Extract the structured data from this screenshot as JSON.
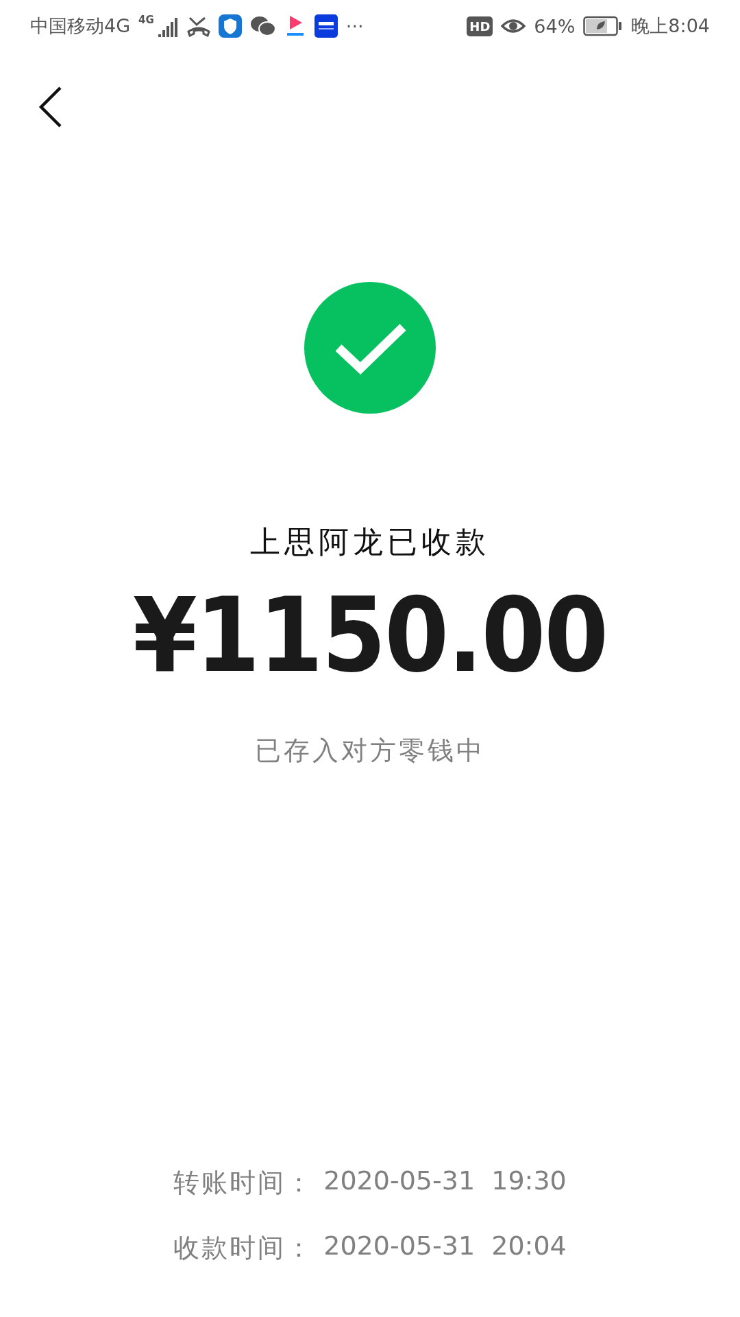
{
  "status_bar": {
    "carrier": "中国移动4G",
    "network": "4G",
    "more": "···",
    "hd": "HD",
    "battery": "64%",
    "time": "晚上8:04"
  },
  "result": {
    "title": "上思阿龙已收款",
    "amount": "¥1150.00",
    "note": "已存入对方零钱中"
  },
  "details": [
    {
      "label": "转账时间：",
      "value": "2020-05-31  19:30"
    },
    {
      "label": "收款时间：",
      "value": "2020-05-31  20:04"
    }
  ]
}
